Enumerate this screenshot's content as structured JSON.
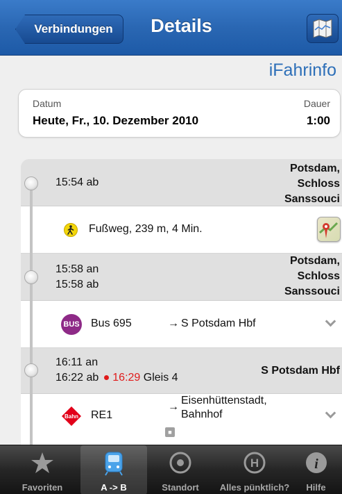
{
  "navbar": {
    "back_label": "Verbindungen",
    "title": "Details",
    "map_icon": "map-icon"
  },
  "brand": "iFahrinfo",
  "date_card": {
    "date_label": "Datum",
    "date_value": "Heute, Fr., 10. Dezember 2010",
    "duration_label": "Dauer",
    "duration_value": "1:00"
  },
  "stops": [
    {
      "times": [
        "15:54 ab"
      ],
      "place": [
        "Potsdam,",
        "Schloss",
        "Sanssouci"
      ]
    },
    {
      "times": [
        "15:58 an",
        "15:58 ab"
      ],
      "place": [
        "Potsdam,",
        "Schloss",
        "Sanssouci"
      ]
    },
    {
      "times": [
        "16:11 an",
        "16:22 ab"
      ],
      "delay_time": "16:29",
      "platform": "Gleis 4",
      "place": [
        "S Potsdam Hbf"
      ]
    }
  ],
  "legs": [
    {
      "icon": "walk-icon",
      "text": "Fußweg, 239 m, 4 Min."
    },
    {
      "icon": "bus-icon",
      "icon_text": "BUS",
      "line": "Bus 695",
      "direction": "S Potsdam Hbf"
    },
    {
      "icon": "bahn-icon",
      "icon_text": "Bahn",
      "line": "RE1",
      "direction": [
        "Eisenhüttenstadt,",
        "Bahnhof"
      ]
    }
  ],
  "tabs": [
    {
      "label": "Favoriten",
      "icon": "star-icon",
      "active": false
    },
    {
      "label": "A -> B",
      "icon": "train-icon",
      "active": true
    },
    {
      "label": "Standort",
      "icon": "location-icon",
      "active": false
    },
    {
      "label": "Alles pünktlich?",
      "icon": "stop-h-icon",
      "active": false
    },
    {
      "label": "Hilfe",
      "icon": "info-icon",
      "active": false
    }
  ],
  "colors": {
    "navbar": "#2a67b3",
    "delay": "#e01b1b",
    "bus": "#8e2a87",
    "bahn": "#e2001a"
  }
}
